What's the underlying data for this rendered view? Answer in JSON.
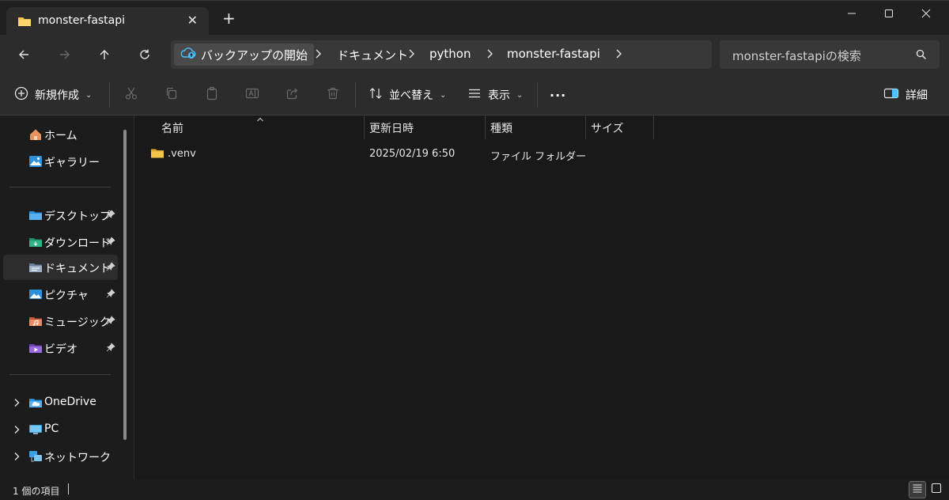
{
  "tab": {
    "title": "monster-fastapi",
    "close_icon": "close-icon",
    "new_tab_label": "+"
  },
  "window_controls": [
    "minimize-icon",
    "maximize-icon",
    "close-icon"
  ],
  "nav": {
    "back": "back-arrow-icon",
    "forward": "forward-arrow-icon",
    "up": "up-arrow-icon",
    "refresh": "refresh-icon"
  },
  "breadcrumb": {
    "root_label": "バックアップの開始",
    "items": [
      "ドキュメント",
      "python",
      "monster-fastapi"
    ]
  },
  "search": {
    "placeholder": "monster-fastapiの検索"
  },
  "toolbar": {
    "new_label": "新規作成",
    "sort_label": "並べ替え",
    "view_label": "表示",
    "more_label": "···",
    "details_label": "詳細"
  },
  "sidebar": {
    "top": [
      {
        "label": "ホーム",
        "icon": "home-icon"
      },
      {
        "label": "ギャラリー",
        "icon": "gallery-icon"
      }
    ],
    "quick": [
      {
        "label": "デスクトップ",
        "icon": "desktop-folder-icon",
        "color": "#2f8fd8"
      },
      {
        "label": "ダウンロード",
        "icon": "download-folder-icon",
        "color": "#24a37a"
      },
      {
        "label": "ドキュメント",
        "icon": "documents-folder-icon",
        "color": "#7b8fa8"
      },
      {
        "label": "ピクチャ",
        "icon": "pictures-folder-icon",
        "color": "#2f8fd8"
      },
      {
        "label": "ミュージック",
        "icon": "music-folder-icon",
        "color": "#e0704a"
      },
      {
        "label": "ビデオ",
        "icon": "videos-folder-icon",
        "color": "#8a56c9"
      }
    ],
    "bottom": [
      {
        "label": "OneDrive",
        "icon": "onedrive-icon"
      },
      {
        "label": "PC",
        "icon": "pc-icon"
      },
      {
        "label": "ネットワーク",
        "icon": "network-icon"
      }
    ]
  },
  "columns": [
    "名前",
    "更新日時",
    "種類",
    "サイズ"
  ],
  "files": [
    {
      "name": ".venv",
      "modified": "2025/02/19 6:50",
      "type": "ファイル フォルダー",
      "size": ""
    }
  ],
  "status": {
    "item_count": "1 個の項目"
  },
  "colors": {
    "accent": "#4cc2ff",
    "folder": "#f4c548",
    "background": "#191919"
  }
}
